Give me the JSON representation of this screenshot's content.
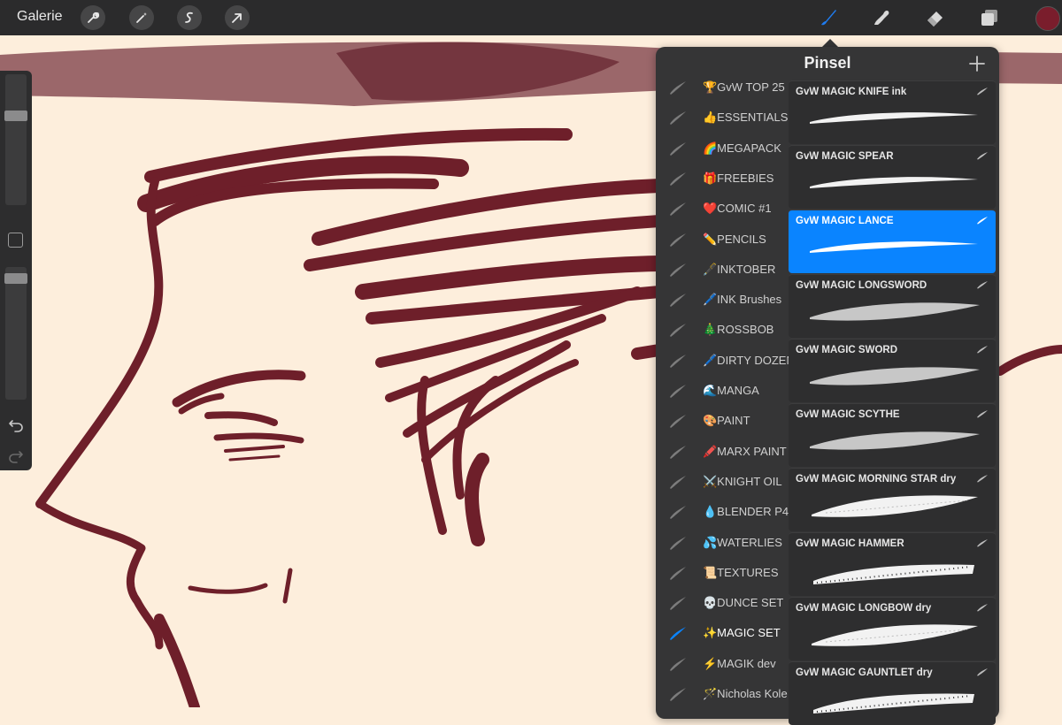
{
  "toolbar": {
    "gallery_label": "Galerie",
    "left_tools": [
      {
        "name": "wrench-icon"
      },
      {
        "name": "magic-wand-icon"
      },
      {
        "name": "selection-s-icon"
      },
      {
        "name": "transform-arrow-icon"
      }
    ],
    "right_tools": [
      {
        "name": "brush-icon",
        "active": true
      },
      {
        "name": "smudge-icon",
        "active": false
      },
      {
        "name": "eraser-icon",
        "active": false
      },
      {
        "name": "layers-icon",
        "active": false
      }
    ],
    "current_color": "#7a1d2c"
  },
  "sidebar": {
    "size_slider_level": 0.7,
    "opacity_slider_level": 0.95
  },
  "brush_panel": {
    "title": "Pinsel",
    "sets": [
      {
        "label": "🏆GvW TOP 25"
      },
      {
        "label": "👍ESSENTIALS"
      },
      {
        "label": "🌈MEGAPACK"
      },
      {
        "label": "🎁FREEBIES"
      },
      {
        "label": "❤️COMIC #1"
      },
      {
        "label": "✏️PENCILS"
      },
      {
        "label": "🖋️INKTOBER"
      },
      {
        "label": "🖊️INK Brushes"
      },
      {
        "label": "🎄ROSSBOB"
      },
      {
        "label": "🖊️DIRTY DOZEN"
      },
      {
        "label": "🌊MANGA"
      },
      {
        "label": "🎨PAINT"
      },
      {
        "label": "🖍️MARX PAINT"
      },
      {
        "label": "⚔️KNIGHT OIL"
      },
      {
        "label": "💧BLENDER P4"
      },
      {
        "label": "💦WATERLIES"
      },
      {
        "label": "📜TEXTURES"
      },
      {
        "label": "💀DUNCE SET"
      },
      {
        "label": "✨MAGIC SET",
        "active": true
      },
      {
        "label": "⚡MAGIK dev"
      },
      {
        "label": "🪄Nicholas Kole"
      }
    ],
    "brushes": [
      {
        "name": "GvW MAGIC KNIFE ink",
        "style": "ink"
      },
      {
        "name": "GvW MAGIC SPEAR",
        "style": "ink"
      },
      {
        "name": "GvW MAGIC LANCE",
        "style": "ink",
        "selected": true
      },
      {
        "name": "GvW MAGIC LONGSWORD",
        "style": "soft"
      },
      {
        "name": "GvW MAGIC SWORD",
        "style": "soft"
      },
      {
        "name": "GvW MAGIC SCYTHE",
        "style": "soft"
      },
      {
        "name": "GvW MAGIC MORNING STAR dry",
        "style": "dry"
      },
      {
        "name": "GvW MAGIC HAMMER",
        "style": "rough"
      },
      {
        "name": "GvW MAGIC LONGBOW dry",
        "style": "dry"
      },
      {
        "name": "GvW MAGIC GAUNTLET dry",
        "style": "rough"
      }
    ]
  },
  "colors": {
    "canvas_bg": "#fdeedc",
    "ink": "#6e1f2a",
    "accent_blue": "#0a84ff"
  }
}
